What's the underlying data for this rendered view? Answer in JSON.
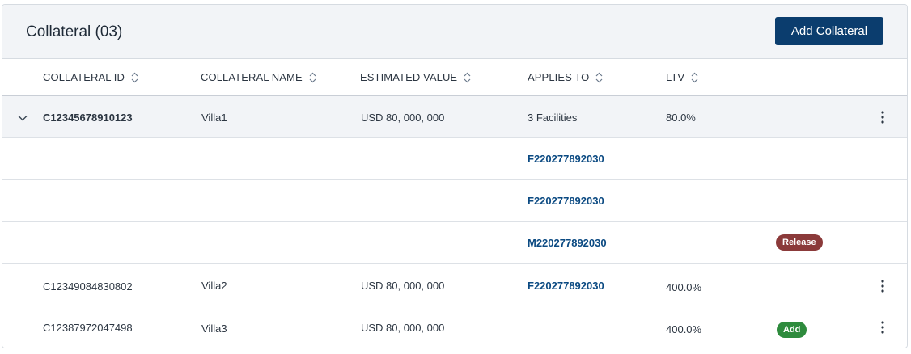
{
  "header": {
    "title": "Collateral (03)",
    "add_button_label": "Add Collateral"
  },
  "columns": [
    {
      "label": "COLLATERAL ID"
    },
    {
      "label": "COLLATERAL NAME"
    },
    {
      "label": "ESTIMATED VALUE"
    },
    {
      "label": "APPLIES TO"
    },
    {
      "label": "LTV"
    }
  ],
  "rows": [
    {
      "id": "C12345678910123",
      "name": "Villa1",
      "value": "USD 80, 000, 000",
      "applies_to": "3 Facilities",
      "ltv": "80.0%",
      "expanded": true,
      "facilities": [
        {
          "code": "F220277892030"
        },
        {
          "code": "F220277892030"
        },
        {
          "code": "M220277892030",
          "badge": "Release"
        }
      ]
    },
    {
      "id": "C12349084830802",
      "name": "Villa2",
      "value": "USD 80, 000, 000",
      "applies_to": "F220277892030",
      "ltv": "400.0%"
    },
    {
      "id": "C12387972047498",
      "name": "Villa3",
      "value": "USD 80, 000, 000",
      "applies_to": "",
      "ltv": "400.0%",
      "badge": "Add"
    }
  ],
  "colors": {
    "primary": "#0b3d6e",
    "link": "#0b4a82",
    "release_badge": "#8b3a3a",
    "add_badge": "#2e8b3d",
    "header_bg": "#f2f4f7"
  },
  "icons": {
    "sort": "sort-icon",
    "chevron": "chevron-down-icon",
    "more": "kebab-menu-icon"
  }
}
